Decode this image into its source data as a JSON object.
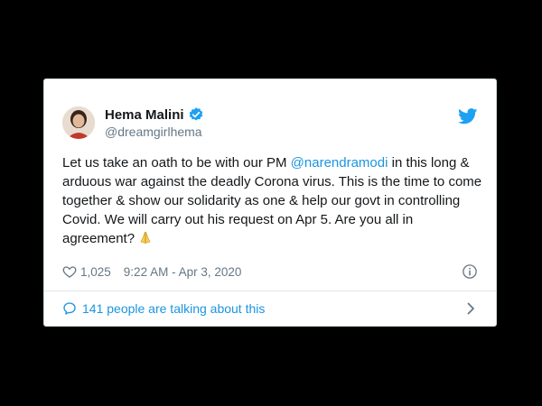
{
  "tweet": {
    "author_name": "Hema Malini",
    "author_handle": "@dreamgirlhema",
    "text_part1": "Let us take an oath to be with our PM ",
    "mention": "@narendramodi",
    "text_part2": " in this long & arduous war against the deadly Corona virus. This is the time to come together & show our solidarity as one & help our govt in controlling Covid. We will carry out his request on Apr 5. Are you all in agreement?",
    "emoji_icon": "folded-hands-icon",
    "like_count": "1,025",
    "timestamp": "9:22 AM - Apr 3, 2020",
    "talking_text": "141 people are talking about this"
  },
  "colors": {
    "accent": "#1b95e0",
    "verified": "#1da1f2",
    "text": "#14171a",
    "muted": "#657786",
    "background": "#000000"
  },
  "icons": {
    "verified": "verified-badge-icon",
    "logo": "twitter-bird-icon",
    "like": "heart-icon",
    "info": "info-icon",
    "reply": "speech-bubble-icon",
    "chevron": "chevron-right-icon"
  }
}
